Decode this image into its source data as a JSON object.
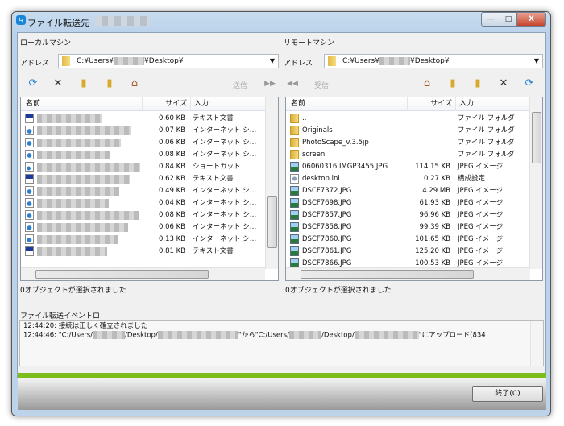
{
  "window": {
    "title": "ファイル転送先",
    "minimize": "—",
    "maximize": "□",
    "close": "X"
  },
  "local": {
    "heading": "ローカルマシン",
    "address_label": "アドレス",
    "address_prefix": "C:¥Users¥",
    "address_suffix": "¥Desktop¥",
    "send_label": "送信",
    "columns": [
      "名前",
      "サイズ",
      "入力"
    ],
    "rows": [
      {
        "size": "0.60 KB",
        "type": "テキスト文書",
        "icon": "text-file"
      },
      {
        "size": "0.07 KB",
        "type": "インターネット シ…",
        "icon": "internet-shortcut"
      },
      {
        "size": "0.06 KB",
        "type": "インターネット シ…",
        "icon": "internet-shortcut"
      },
      {
        "size": "0.08 KB",
        "type": "インターネット シ…",
        "icon": "internet-shortcut"
      },
      {
        "size": "0.84 KB",
        "type": "ショートカット",
        "icon": "shortcut"
      },
      {
        "size": "0.62 KB",
        "type": "テキスト文書",
        "icon": "text-file"
      },
      {
        "size": "0.49 KB",
        "type": "インターネット シ…",
        "icon": "internet-shortcut"
      },
      {
        "size": "0.04 KB",
        "type": "インターネット シ…",
        "icon": "internet-shortcut"
      },
      {
        "size": "0.08 KB",
        "type": "インターネット シ…",
        "icon": "internet-shortcut"
      },
      {
        "size": "0.06 KB",
        "type": "インターネット シ…",
        "icon": "internet-shortcut"
      },
      {
        "size": "0.13 KB",
        "type": "インターネット シ…",
        "icon": "internet-shortcut"
      },
      {
        "size": "0.81 KB",
        "type": "テキスト文書",
        "icon": "text-file"
      }
    ],
    "status": "0オブジェクトが選択されました"
  },
  "remote": {
    "heading": "リモートマシン",
    "address_label": "アドレス",
    "address_prefix": "C:¥Users¥",
    "address_suffix": "¥Desktop¥",
    "receive_label": "受信",
    "columns": [
      "名前",
      "サイズ",
      "入力"
    ],
    "rows": [
      {
        "name": "..",
        "size": "",
        "type": "ファイル フォルダ",
        "icon": "folder"
      },
      {
        "name": "Originals",
        "size": "",
        "type": "ファイル フォルダ",
        "icon": "folder"
      },
      {
        "name": "PhotoScape_v.3.5jp",
        "size": "",
        "type": "ファイル フォルダ",
        "icon": "folder"
      },
      {
        "name": "screen",
        "size": "",
        "type": "ファイル フォルダ",
        "icon": "folder"
      },
      {
        "name": "06060316.IMGP3455.JPG",
        "size": "114.15 KB",
        "type": "JPEG イメージ",
        "icon": "image"
      },
      {
        "name": "desktop.ini",
        "size": "0.27 KB",
        "type": "構成設定",
        "icon": "settings-file"
      },
      {
        "name": "DSCF7372.JPG",
        "size": "4.29 MB",
        "type": "JPEG イメージ",
        "icon": "image"
      },
      {
        "name": "DSCF7698.JPG",
        "size": "61.93 KB",
        "type": "JPEG イメージ",
        "icon": "image"
      },
      {
        "name": "DSCF7857.JPG",
        "size": "96.96 KB",
        "type": "JPEG イメージ",
        "icon": "image"
      },
      {
        "name": "DSCF7858.JPG",
        "size": "99.39 KB",
        "type": "JPEG イメージ",
        "icon": "image"
      },
      {
        "name": "DSCF7860.JPG",
        "size": "101.65 KB",
        "type": "JPEG イメージ",
        "icon": "image"
      },
      {
        "name": "DSCF7861.JPG",
        "size": "125.20 KB",
        "type": "JPEG イメージ",
        "icon": "image"
      },
      {
        "name": "DSCF7866.JPG",
        "size": "100.53 KB",
        "type": "JPEG イメージ",
        "icon": "image"
      }
    ],
    "status": "0オブジェクトが選択されました"
  },
  "log": {
    "label": "ファイル転送イベントロ",
    "lines": [
      {
        "time": "12:44:20:",
        "text": "接続は正しく確立されました"
      },
      {
        "time": "12:44:46:",
        "p1": "\"C:/Users/",
        "p2": "/Desktop/",
        "p3": "\"から\"C:/Users/",
        "p4": "/Desktop/",
        "p5": "\"にアップロード(834"
      }
    ]
  },
  "footer": {
    "close_label": "終了(C)"
  },
  "colors": {
    "accent_bar": "#7dbd1b",
    "title_bar": "#c7dcef"
  }
}
